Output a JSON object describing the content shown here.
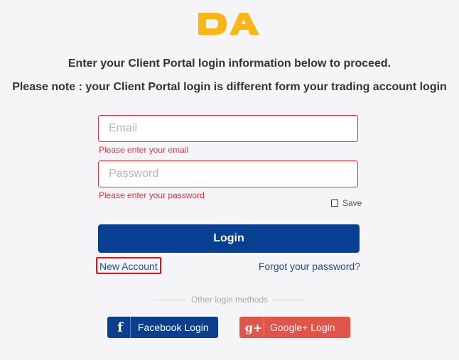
{
  "brand": {
    "logo_text": "DA",
    "logo_color": "#fbb515"
  },
  "intro": {
    "line1": "Enter your Client Portal login information below to proceed.",
    "line2": "Please note : your Client Portal login is different form your trading account login"
  },
  "form": {
    "email_placeholder": "Email",
    "email_value": "",
    "email_error": "Please enter your email",
    "password_placeholder": "Password",
    "password_value": "",
    "password_error": "Please enter your password",
    "save_label": "Save",
    "save_checked": false,
    "login_label": "Login"
  },
  "links": {
    "new_account": "New Account",
    "forgot_password": "Forgot your password?"
  },
  "social": {
    "divider_text": "Other login methods",
    "facebook_icon": "f",
    "facebook_label": "Facebook Login",
    "google_icon": "g+",
    "google_label": "Google+ Login"
  },
  "colors": {
    "primary": "#074093",
    "error": "#e4374a",
    "link": "#1b4c94",
    "facebook": "#0b3f8c",
    "google": "#df5549",
    "highlight": "#e3111c"
  }
}
